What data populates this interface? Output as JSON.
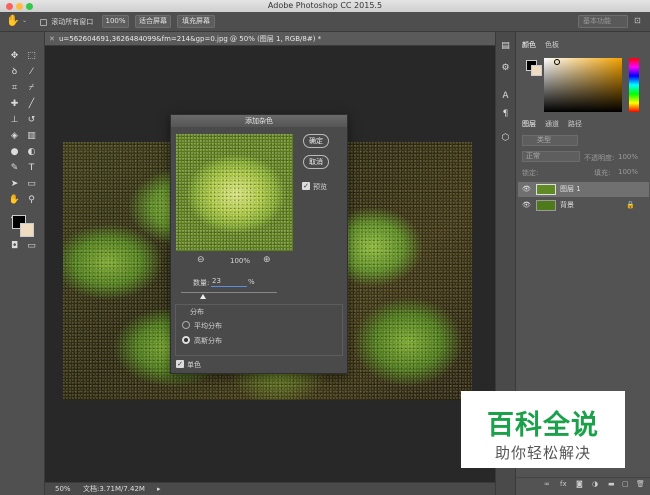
{
  "app": {
    "title": "Adobe Photoshop CC 2015.5"
  },
  "options_bar": {
    "scroll_all_label": "滚动所有窗口",
    "zoom_100_label": "100%",
    "fit_screen_label": "适合屏幕",
    "fill_screen_label": "填充屏幕",
    "workspace_label": "基本功能"
  },
  "document": {
    "tab_title": "u=562604691,3626484099&fm=214&gp=0.jpg @ 50% (图层 1, RGB/8#) *",
    "status_zoom": "50%",
    "status_doc": "文档:3.71M/7.42M"
  },
  "dialog": {
    "title": "添加杂色",
    "ok_label": "确定",
    "cancel_label": "取消",
    "preview_label": "预览",
    "zoom_value": "100%",
    "amount_label": "数量:",
    "amount_value": "23",
    "amount_unit": "%",
    "amount_fraction": 0.23,
    "distribution_title": "分布",
    "uniform_label": "平均分布",
    "gaussian_label": "高斯分布",
    "mono_label": "单色"
  },
  "panels": {
    "color_tab": "颜色",
    "swatches_tab": "色板",
    "layers_tab": "图层",
    "channels_tab": "通道",
    "paths_tab": "路径",
    "kind_label": "类型",
    "blend_mode": "正常",
    "opacity_label": "不透明度:",
    "opacity_value": "100%",
    "lock_label": "锁定:",
    "fill_label": "填充:",
    "fill_value": "100%",
    "layers": [
      {
        "name": "图层 1"
      },
      {
        "name": "背景"
      }
    ]
  },
  "watermark": {
    "title": "百科全说",
    "subtitle": "助你轻松解决"
  },
  "colors": {
    "accent_green": "#1aa14a",
    "foreground": "#000000",
    "background": "#f0dcc0"
  }
}
